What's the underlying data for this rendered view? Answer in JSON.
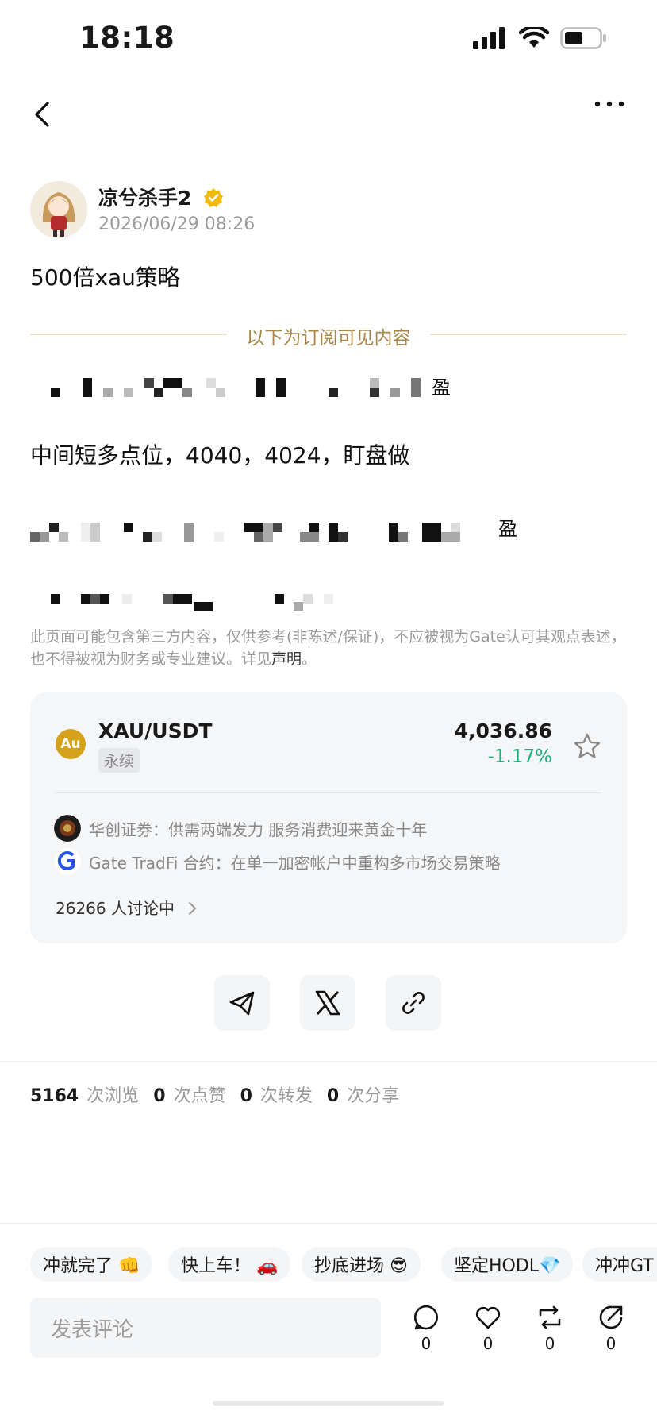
{
  "status_bar": {
    "time": "18:18"
  },
  "post": {
    "author": "凉兮杀手2",
    "time": "2026/06/29 08:26",
    "title": "500倍xau策略",
    "divider_text": "以下为订阅可见内容",
    "visible_line": "中间短多点位，4040，4024，盯盘做",
    "obscured_fragment_1": "盈",
    "obscured_fragment_2": "盈",
    "disclaimer_text": "此页面可能包含第三方内容，仅供参考(非陈述/保证)，不应被视为Gate认可其观点表述，也不得被视为财务或专业建议。详见",
    "disclaimer_link": "声明",
    "disclaimer_end": "。"
  },
  "market": {
    "coin_icon_text": "Au",
    "pair": "XAU/USDT",
    "type": "永续",
    "price": "4,036.86",
    "change": "-1.17%",
    "change_color": "#1eae7a",
    "news": [
      {
        "text": "华创证券：供需两端发力 服务消费迎来黄金十年"
      },
      {
        "text": "Gate TradFi 合约：在单一加密帐户中重构多市场交易策略"
      }
    ],
    "discussion": "26266 人讨论中"
  },
  "stats": {
    "views": "5164",
    "views_label": "次浏览",
    "likes": "0",
    "likes_label": "次点赞",
    "reposts": "0",
    "reposts_label": "次转发",
    "shares": "0",
    "shares_label": "次分享"
  },
  "chips": [
    "冲就完了 👊",
    "快上车！ 🚗",
    "抄底进场 😎",
    "坚定HODL💎",
    "冲冲GT"
  ],
  "comment_placeholder": "发表评论",
  "actions": {
    "comment": "0",
    "like": "0",
    "repost": "0",
    "share": "0"
  }
}
